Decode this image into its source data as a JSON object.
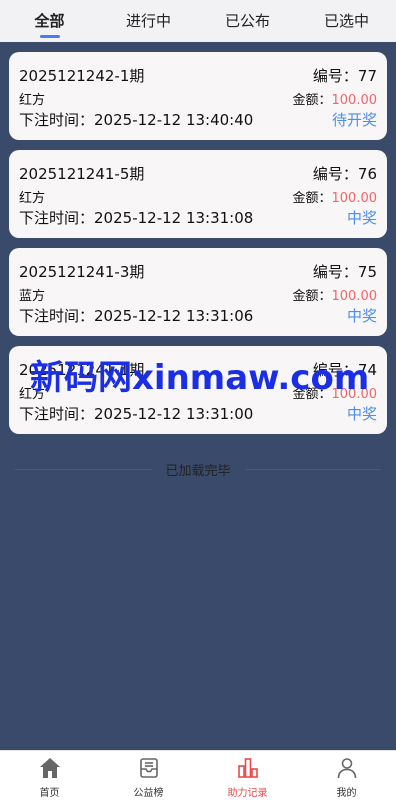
{
  "tabs": [
    {
      "label": "全部",
      "active": true
    },
    {
      "label": "进行中",
      "active": false
    },
    {
      "label": "已公布",
      "active": false
    },
    {
      "label": "已选中",
      "active": false
    }
  ],
  "records": [
    {
      "period": "2025121242-1期",
      "number_label": "编号：",
      "number": "77",
      "team": "红方",
      "amount_label": "金额：",
      "amount": "100.00",
      "time_label": "下注时间：",
      "time": "2025-12-12 13:40:40",
      "status": "待开奖"
    },
    {
      "period": "2025121241-5期",
      "number_label": "编号：",
      "number": "76",
      "team": "红方",
      "amount_label": "金额：",
      "amount": "100.00",
      "time_label": "下注时间：",
      "time": "2025-12-12 13:31:08",
      "status": "中奖"
    },
    {
      "period": "2025121241-3期",
      "number_label": "编号：",
      "number": "75",
      "team": "蓝方",
      "amount_label": "金额：",
      "amount": "100.00",
      "time_label": "下注时间：",
      "time": "2025-12-12 13:31:06",
      "status": "中奖"
    },
    {
      "period": "2025121241-1期",
      "number_label": "编号：",
      "number": "74",
      "team": "红方",
      "amount_label": "金额：",
      "amount": "100.00",
      "time_label": "下注时间：",
      "time": "2025-12-12 13:31:00",
      "status": "中奖"
    }
  ],
  "loaded_text": "已加载完毕",
  "watermark": "新码网xinmaw.com",
  "nav": [
    {
      "label": "首页",
      "icon": "home-icon"
    },
    {
      "label": "公益榜",
      "icon": "inbox-icon"
    },
    {
      "label": "助力记录",
      "icon": "chart-icon",
      "active": true
    },
    {
      "label": "我的",
      "icon": "user-icon"
    }
  ],
  "colors": {
    "accent": "#4a7cf0",
    "amount": "#f0666a",
    "status": "#4a8ff0",
    "nav_active": "#e84a4a",
    "background": "#3a4a6b"
  }
}
